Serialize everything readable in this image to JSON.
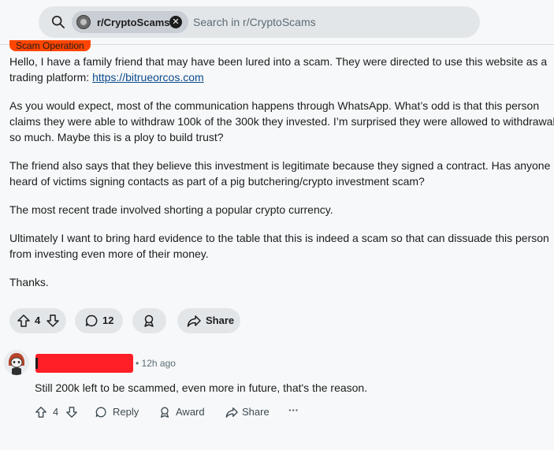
{
  "search": {
    "community_chip": "r/CryptoScams",
    "placeholder": "Search in r/CryptoScams"
  },
  "post": {
    "flair": "Scam Operation",
    "paragraph1_text": "Hello, I have a family friend that may have been lured into a scam. They were directed to use this website as a trading platform: ",
    "link": "https://bitrueorcos.com",
    "paragraph2": "As you would expect, most of the communication happens through WhatsApp. What’s odd is that this person claims they were able to withdraw 100k of the 300k they invested. I’m surprised they were allowed to withdrawal so much. Maybe this is a ploy to build trust?",
    "paragraph3": "The friend also says that they believe this investment is legitimate because they signed a contract. Has anyone heard of victims signing contacts as part of a pig butchering/crypto investment scam?",
    "paragraph4": "The most recent trade involved shorting a popular crypto currency.",
    "paragraph5": "Ultimately I want to bring hard evidence to the table that this is indeed a scam so that can dissuade this person from investing even more of their money.",
    "paragraph6": "Thanks.",
    "actions": {
      "vote_count": "4",
      "comment_count": "12",
      "share_label": "Share"
    }
  },
  "comment": {
    "meta": "• 12h ago",
    "body": "Still 200k left to be scammed, even more in future, that's the reason.",
    "actions": {
      "vote_count": "4",
      "reply_label": "Reply",
      "award_label": "Award",
      "share_label": "Share",
      "more_label": "···"
    }
  },
  "colors": {
    "flair_bg": "#ff4500",
    "redaction": "#ff1f26",
    "link": "#0a4a8c"
  }
}
